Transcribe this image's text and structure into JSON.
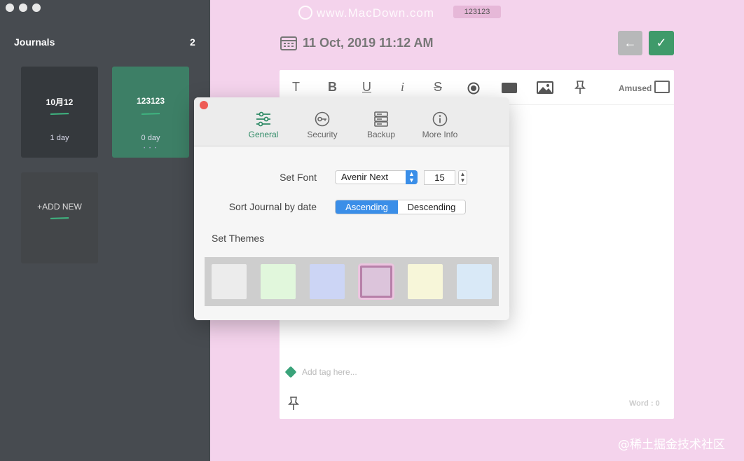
{
  "sidebar": {
    "title": "Journals",
    "count": "2",
    "journals": [
      {
        "title": "10月12",
        "sub": "1 day"
      },
      {
        "title": "123123",
        "sub": "0 day",
        "dots": "• • •"
      }
    ],
    "add_new": "+ADD NEW"
  },
  "header": {
    "watermark": "www.MacDown.com",
    "entry_title": "123123",
    "date": "11 Oct, 2019 11:12 AM",
    "back_icon": "←",
    "save_icon": "✓"
  },
  "editor": {
    "toolbar": {
      "text_icon": "T",
      "bold_icon": "B",
      "underline_icon": "U",
      "italic_icon": "i",
      "strike_icon": "S",
      "mood": "Amused"
    },
    "tag_placeholder": "Add tag here...",
    "word_count": "Word : 0"
  },
  "prefs": {
    "tabs": [
      "General",
      "Security",
      "Backup",
      "More Info"
    ],
    "active_tab": "General",
    "font_label": "Set Font",
    "font_value": "Avenir Next",
    "size_value": "15",
    "sort_label": "Sort Journal by date",
    "sort_options": [
      "Ascending",
      "Descending"
    ],
    "themes_label": "Set Themes",
    "theme_colors": [
      "#ececec",
      "#e1f7dc",
      "#ccd5f5",
      "#dcc4db",
      "#f7f6d9",
      "#d9e9f7"
    ],
    "accent": "#3a8ee8"
  },
  "footer_watermark": "@稀土掘金技术社区"
}
